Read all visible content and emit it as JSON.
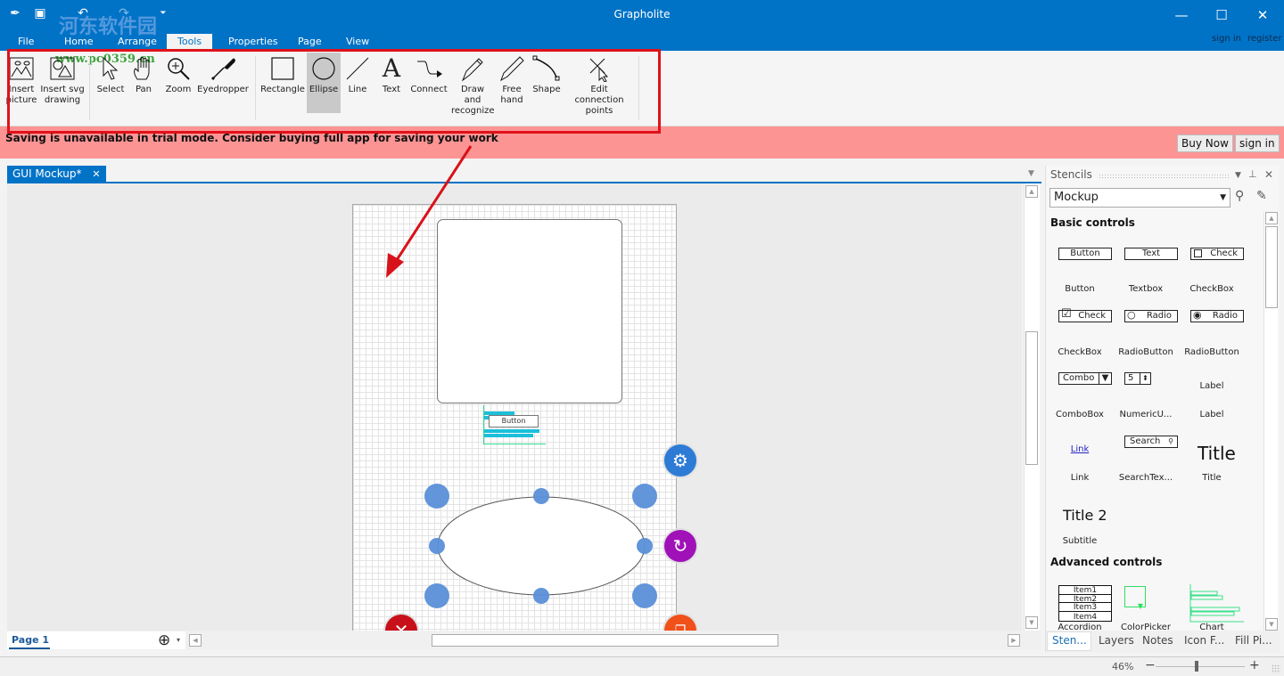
{
  "app": {
    "title": "Grapholite",
    "watermark_line1": "河东软件园",
    "watermark_line2": "www.pc0359.cn"
  },
  "window_controls": {
    "minimize": "—",
    "maximize": "☐",
    "close": "✕"
  },
  "quick_access": {
    "save_icon": "💾",
    "undo_icon": "↶",
    "redo_icon": "↷",
    "customize_icon": "⏷"
  },
  "ribbon_tabs": [
    {
      "label": "File"
    },
    {
      "label": "Home"
    },
    {
      "label": "Arrange"
    },
    {
      "label": "Tools",
      "active": true
    },
    {
      "label": "Properties"
    },
    {
      "label": "Page"
    },
    {
      "label": "View"
    }
  ],
  "account": {
    "sign_in": "sign in",
    "register": "register"
  },
  "tools": [
    {
      "label": "Insert\npicture",
      "icon": "picture-icon"
    },
    {
      "label": "Insert svg\ndrawing",
      "icon": "svg-icon"
    },
    {
      "label": "Select",
      "icon": "pointer-icon"
    },
    {
      "label": "Pan",
      "icon": "hand-icon"
    },
    {
      "label": "Zoom",
      "icon": "magnifier-icon"
    },
    {
      "label": "Eyedropper",
      "icon": "eyedropper-icon"
    },
    {
      "label": "Rectangle",
      "icon": "rectangle-icon"
    },
    {
      "label": "Ellipse",
      "icon": "ellipse-icon",
      "selected": true
    },
    {
      "label": "Line",
      "icon": "line-icon"
    },
    {
      "label": "Text",
      "icon": "text-icon"
    },
    {
      "label": "Connect",
      "icon": "connector-icon"
    },
    {
      "label": "Draw and\nrecognize",
      "icon": "pen-icon"
    },
    {
      "label": "Free\nhand",
      "icon": "pencil-icon"
    },
    {
      "label": "Shape",
      "icon": "bezier-icon"
    },
    {
      "label": "Edit connection\npoints",
      "icon": "connection-points-icon"
    }
  ],
  "banner": {
    "message": "Saving is unavailable in trial mode. Consider buying full app for saving your work",
    "buy_now": "Buy Now",
    "sign_in": "sign in",
    "color": "#fd9494"
  },
  "document": {
    "tab_label": "GUI Mockup*",
    "tab_close": "✕",
    "canvas_button_text": "Button",
    "page_tab": "Page 1",
    "add_page": "⊕",
    "add_page_menu": "▾"
  },
  "stencils_panel": {
    "title": "Stencils",
    "selected_set": "Mockup",
    "sections": [
      {
        "title": "Basic controls",
        "items": [
          {
            "preview": "Button",
            "name": "Button"
          },
          {
            "preview": "Text",
            "name": "Textbox"
          },
          {
            "preview": "Check",
            "name": "CheckBox"
          },
          {
            "preview": "Check",
            "name": "CheckBox"
          },
          {
            "preview": "Radio",
            "name": "RadioButton"
          },
          {
            "preview": "Radio",
            "name": "RadioButton"
          },
          {
            "preview": "Combo",
            "name": "ComboBox"
          },
          {
            "preview": "5",
            "name": "NumericU..."
          },
          {
            "preview": "Label",
            "name": "Label"
          },
          {
            "preview": "Link",
            "name": "Link"
          },
          {
            "preview": "Search",
            "name": "SearchTex..."
          },
          {
            "preview": "Title",
            "name": "Title"
          },
          {
            "preview": "Title 2",
            "name": "Subtitle"
          }
        ]
      },
      {
        "title": "Advanced controls",
        "items": [
          {
            "preview": [
              "Item1",
              "Item2",
              "Item3",
              "Item4"
            ],
            "name": "Accordion"
          },
          {
            "preview": "",
            "name": "ColorPicker"
          },
          {
            "preview": "",
            "name": "Chart"
          }
        ]
      }
    ],
    "bottom_tabs": [
      {
        "label": "Sten...",
        "active": true
      },
      {
        "label": "Layers"
      },
      {
        "label": "Notes"
      },
      {
        "label": "Icon F..."
      },
      {
        "label": "Fill Pi..."
      }
    ]
  },
  "status": {
    "zoom_level": "46%",
    "zoom_minus": "−",
    "zoom_plus": "+",
    "zoom_slider_fraction": 0.46
  },
  "colors": {
    "titlebar": "#0173c7",
    "selection_handle": "#5a8fd8",
    "settings_fab": "#2d7bd5",
    "rotate_fab": "#a012b8",
    "delete_fab": "#c8101a",
    "duplicate_fab": "#f0501a",
    "annotation_red": "#e0121a"
  }
}
